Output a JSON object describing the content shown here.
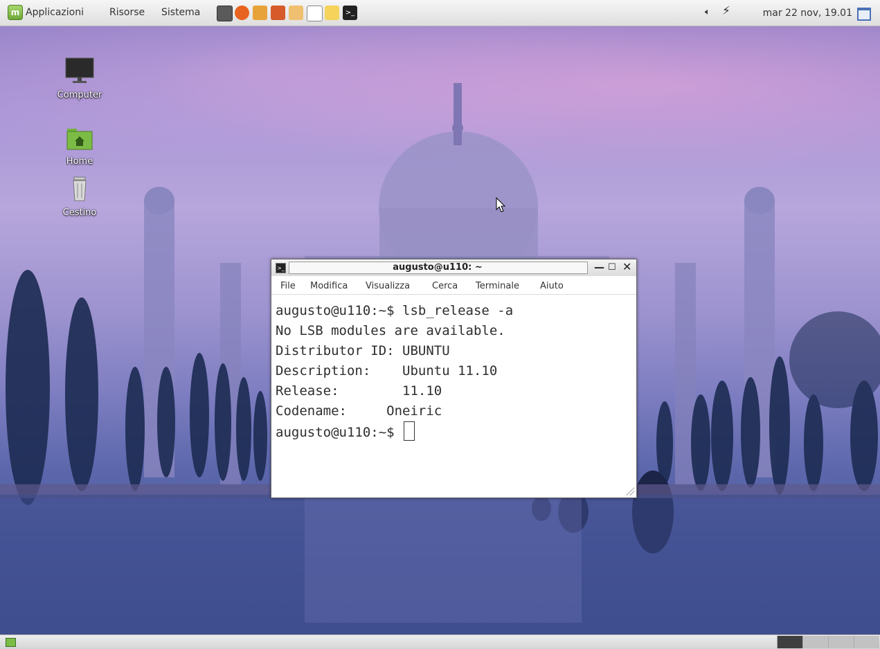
{
  "panel": {
    "menus": [
      "Applicazioni",
      "Risorse",
      "Sistema"
    ],
    "clock": "mar 22 nov, 19.01"
  },
  "desktop": {
    "icons": [
      {
        "label": "Computer"
      },
      {
        "label": "Home"
      },
      {
        "label": "Cestino"
      }
    ]
  },
  "terminal": {
    "title": "augusto@u110: ~",
    "menus": [
      "File",
      "Modifica",
      "Visualizza",
      "Cerca",
      "Terminale",
      "Aiuto"
    ],
    "lines": [
      "augusto@u110:~$ lsb_release -a",
      "No LSB modules are available.",
      "Distributor ID:\tUBUNTU",
      "Description:\tUbuntu 11.10",
      "Release:\t11.10",
      "Codename:\tOneiric"
    ],
    "prompt": "augusto@u110:~$ "
  },
  "colors": {
    "panel_bg": "#e6e6e6",
    "terminal_text": "#2e2e2e",
    "mint_green": "#7cbc46"
  }
}
